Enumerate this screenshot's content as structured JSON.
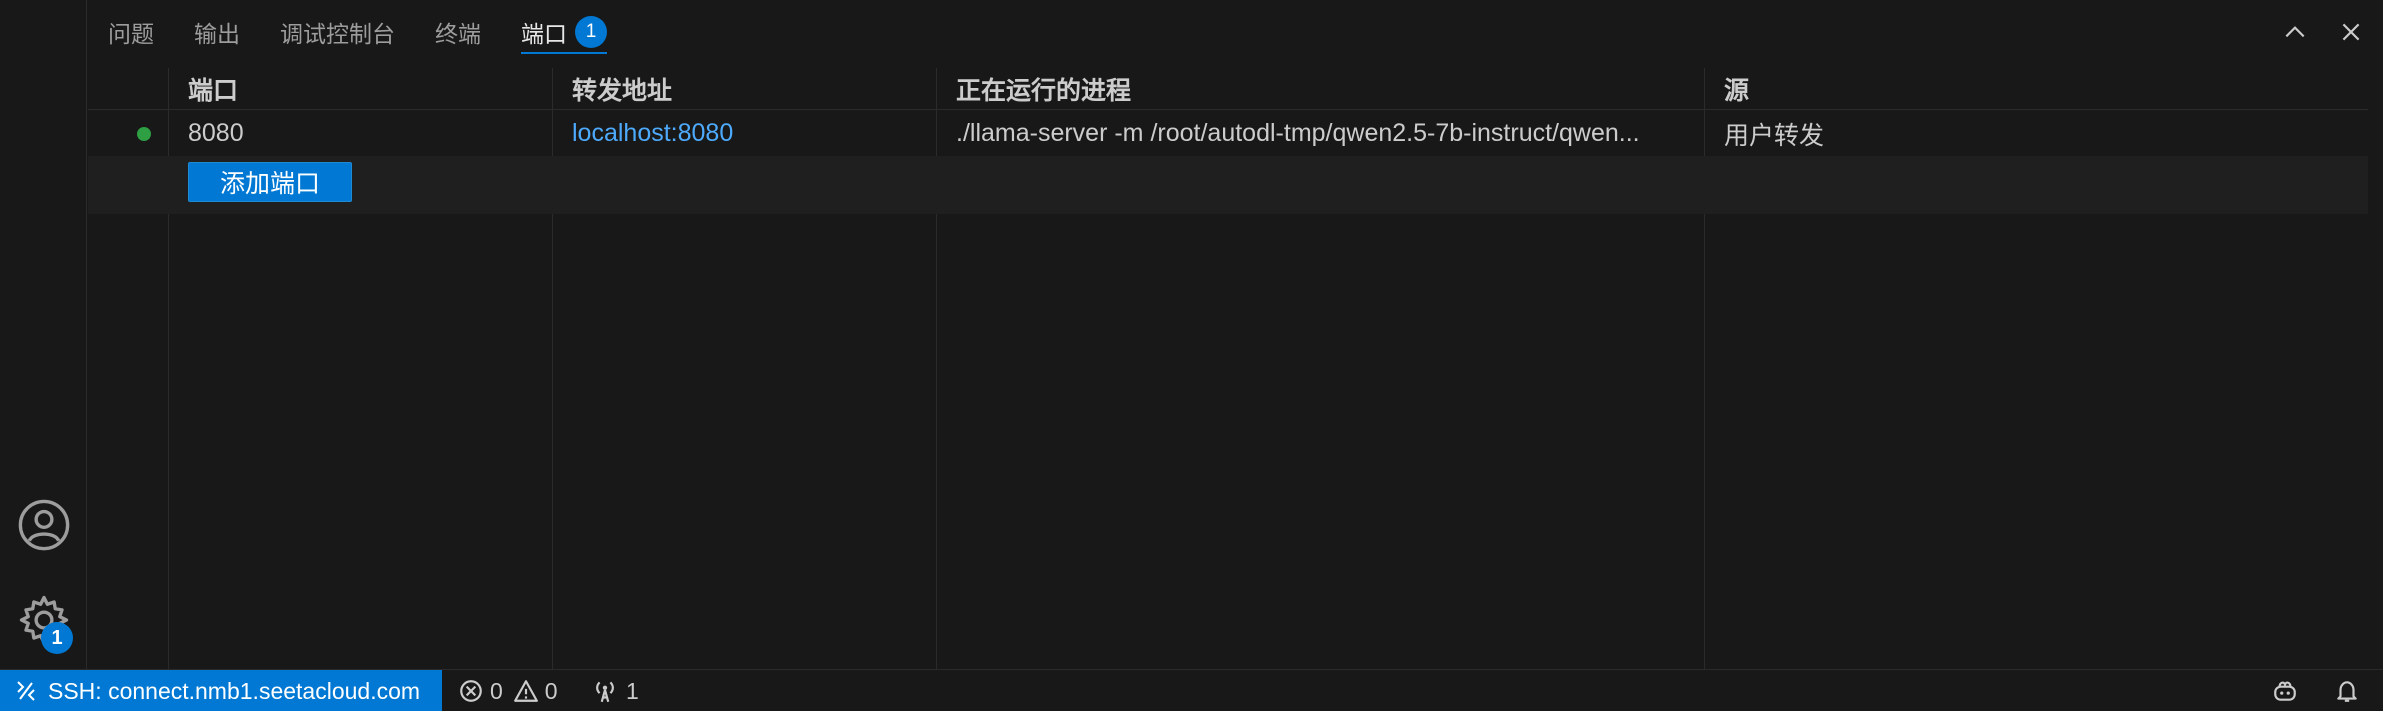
{
  "activity_bar": {
    "settings_badge": "1"
  },
  "panel": {
    "tabs": [
      {
        "label": "问题"
      },
      {
        "label": "输出"
      },
      {
        "label": "调试控制台"
      },
      {
        "label": "终端"
      },
      {
        "label": "端口",
        "badge": "1",
        "active": true
      }
    ]
  },
  "ports_table": {
    "columns": [
      "端口",
      "转发地址",
      "正在运行的进程",
      "源"
    ],
    "rows": [
      {
        "port": "8080",
        "address": "localhost:8080",
        "process": "./llama-server -m /root/autodl-tmp/qwen2.5-7b-instruct/qwen...",
        "origin": "用户转发",
        "status_color": "#2ea043"
      }
    ],
    "add_button_label": "添加端口"
  },
  "status_bar": {
    "remote_label": "SSH: connect.nmb1.seetacloud.com",
    "errors": "0",
    "warnings": "0",
    "ports_count": "1"
  },
  "colors": {
    "accent": "#0078d4",
    "link": "#4daafc",
    "background": "#181818"
  }
}
